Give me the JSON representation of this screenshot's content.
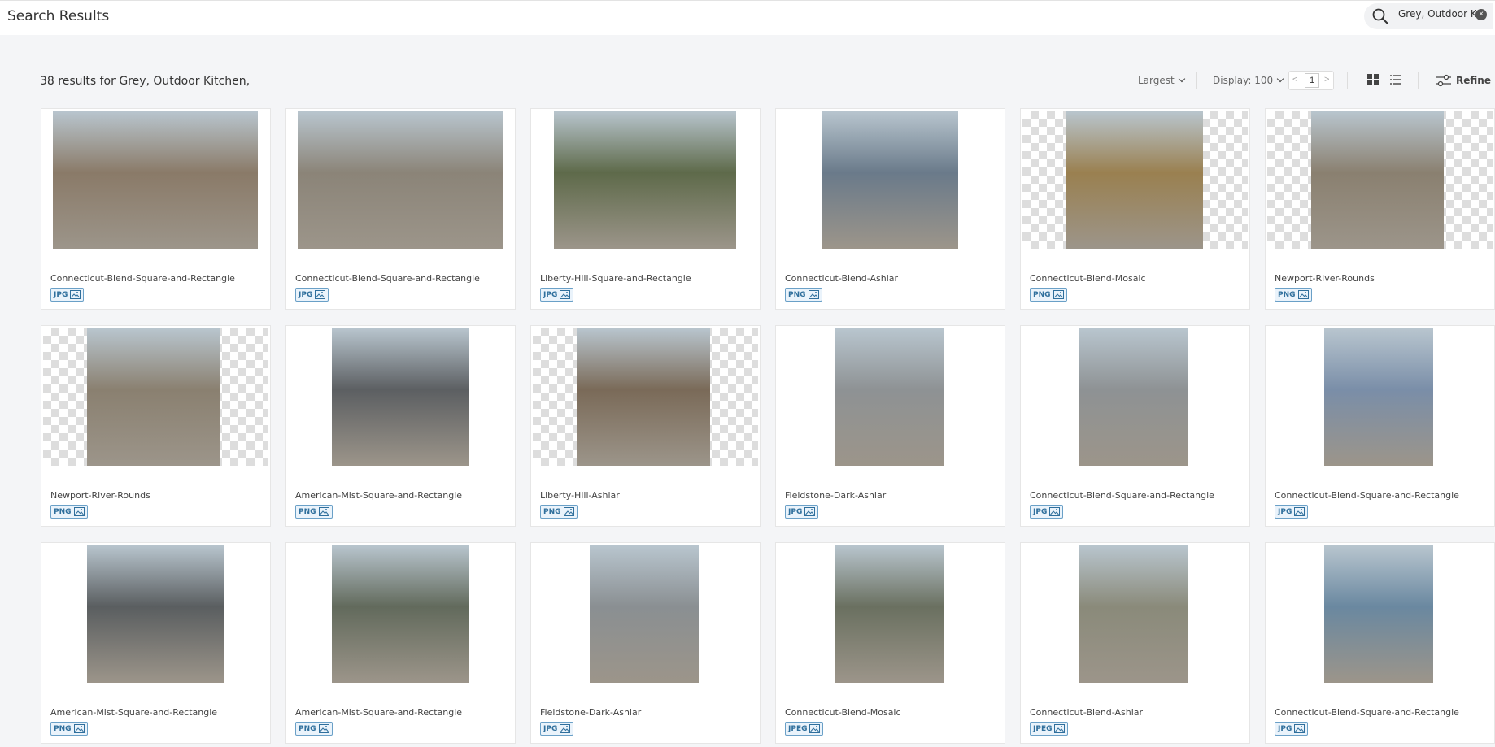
{
  "header": {
    "title": "Search Results"
  },
  "search": {
    "value": "Grey, Outdoor Kit"
  },
  "results": {
    "summary": "38 results for Grey, Outdoor Kitchen,"
  },
  "toolbar": {
    "sort_label": "Largest",
    "display_label": "Display: 100",
    "page": "1",
    "prev_symbol": "<",
    "next_symbol": ">",
    "refine_label": "Refine",
    "clear_symbol": "×"
  },
  "colors": {
    "accent": "#2f6f9c",
    "badge_bg": "#eaf3fb"
  },
  "cards": [
    {
      "name": "Connecticut-Blend-Square-and-Rectangle",
      "format": "JPG"
    },
    {
      "name": "Connecticut-Blend-Square-and-Rectangle",
      "format": "JPG"
    },
    {
      "name": "Liberty-Hill-Square-and-Rectangle",
      "format": "JPG"
    },
    {
      "name": "Connecticut-Blend-Ashlar",
      "format": "PNG"
    },
    {
      "name": "Connecticut-Blend-Mosaic",
      "format": "PNG"
    },
    {
      "name": "Newport-River-Rounds",
      "format": "PNG"
    },
    {
      "name": "Newport-River-Rounds",
      "format": "PNG"
    },
    {
      "name": "American-Mist-Square-and-Rectangle",
      "format": "PNG"
    },
    {
      "name": "Liberty-Hill-Ashlar",
      "format": "PNG"
    },
    {
      "name": "Fieldstone-Dark-Ashlar",
      "format": "JPG"
    },
    {
      "name": "Connecticut-Blend-Square-and-Rectangle",
      "format": "JPG"
    },
    {
      "name": "Connecticut-Blend-Square-and-Rectangle",
      "format": "JPG"
    },
    {
      "name": "American-Mist-Square-and-Rectangle",
      "format": "PNG"
    },
    {
      "name": "American-Mist-Square-and-Rectangle",
      "format": "PNG"
    },
    {
      "name": "Fieldstone-Dark-Ashlar",
      "format": "JPG"
    },
    {
      "name": "Connecticut-Blend-Mosaic",
      "format": "JPEG"
    },
    {
      "name": "Connecticut-Blend-Ashlar",
      "format": "JPEG"
    },
    {
      "name": "Connecticut-Blend-Square-and-Rectangle",
      "format": "JPG"
    }
  ]
}
